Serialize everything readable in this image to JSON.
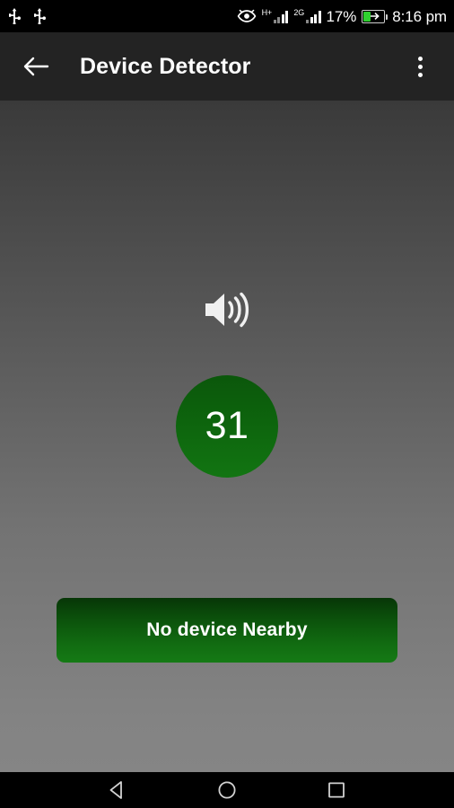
{
  "status_bar": {
    "left_icons": [
      {
        "name": "usb-icon-1",
        "label": "USB"
      },
      {
        "name": "usb-icon-2",
        "label": "USB"
      }
    ],
    "eye_icon": "eye-icon",
    "signal_1_label": "H+",
    "signal_2_label": "2G",
    "battery_percent": "17%",
    "battery_state": "charging",
    "time": "8:16 pm"
  },
  "app_bar": {
    "back_label": "Back",
    "title": "Device Detector",
    "overflow_label": "More options"
  },
  "main": {
    "speaker_icon": "volume-up-icon",
    "counter_value": "31",
    "status_button_label": "No device Nearby"
  },
  "nav_bar": {
    "back_label": "Back",
    "home_label": "Home",
    "recents_label": "Recents"
  },
  "colors": {
    "accent_green": "#0d640d",
    "button_green": "#116b11",
    "app_bar": "#232323",
    "battery_green": "#2fd02f"
  }
}
